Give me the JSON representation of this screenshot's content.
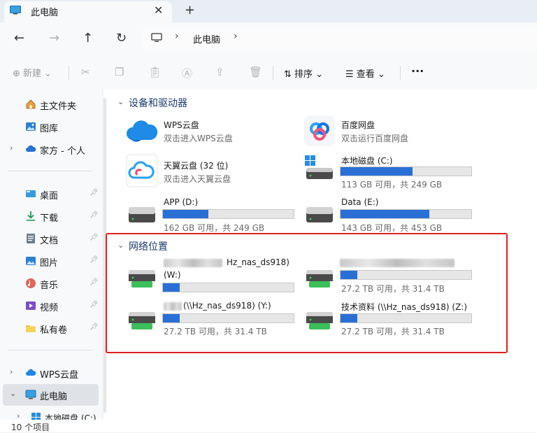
{
  "window": {
    "tab_title": "此电脑",
    "close_glyph": "✕",
    "new_tab_glyph": "+"
  },
  "address": {
    "location": "此电脑",
    "sep": "›"
  },
  "toolbar": {
    "new_label": "新建",
    "sort_label": "排序",
    "view_label": "查看",
    "more_glyph": "···"
  },
  "sidebar": {
    "quick": [
      {
        "label": "主文件夹",
        "icon": "home-icon"
      },
      {
        "label": "图库",
        "icon": "gallery-icon"
      },
      {
        "label": "家方 - 个人",
        "icon": "cloud-icon"
      }
    ],
    "pinned": [
      {
        "label": "桌面",
        "icon": "desktop-icon"
      },
      {
        "label": "下载",
        "icon": "download-icon"
      },
      {
        "label": "文档",
        "icon": "document-icon"
      },
      {
        "label": "图片",
        "icon": "picture-icon"
      },
      {
        "label": "音乐",
        "icon": "music-icon"
      },
      {
        "label": "视频",
        "icon": "video-icon"
      },
      {
        "label": "私有卷",
        "icon": "folder-icon"
      }
    ],
    "tree": [
      {
        "label": "WPS云盘",
        "icon": "wps-cloud-icon"
      },
      {
        "label": "此电脑",
        "icon": "pc-icon",
        "selected": true
      },
      {
        "label": "本地磁盘 (C:)",
        "icon": "windows-drive-icon"
      }
    ]
  },
  "groups": {
    "devices_title": "设备和驱动器",
    "network_title": "网络位置"
  },
  "devices": [
    {
      "name": "WPS云盘",
      "sub": "双击进入WPS云盘",
      "icon": "wps-cloud-logo-icon"
    },
    {
      "name": "百度网盘",
      "sub": "双击运行百度网盘",
      "icon": "baidu-netdisk-icon"
    },
    {
      "name": "天翼云盘 (32 位)",
      "sub": "双击进入天翼云盘",
      "icon": "tianyi-cloud-icon"
    },
    {
      "name": "本地磁盘 (C:)",
      "sub": "113 GB 可用，共 249 GB",
      "usage": 0.55,
      "icon": "windows-drive-icon"
    },
    {
      "name": "APP (D:)",
      "sub": "162 GB 可用，共 249 GB",
      "usage": 0.35,
      "icon": "drive-icon"
    },
    {
      "name": "Data (E:)",
      "sub": "143 GB 可用，共 453 GB",
      "usage": 0.68,
      "icon": "drive-icon"
    }
  ],
  "network": [
    {
      "name": "Hz_nas_ds918)",
      "name2": "(W:)",
      "sub": "",
      "usage": 0.13,
      "icon": "network-drive-icon"
    },
    {
      "name": "",
      "sub": "27.2 TB 可用，共 31.4 TB",
      "usage": 0.13,
      "icon": "network-drive-icon"
    },
    {
      "name": "(\\\\Hz_nas_ds918) (Y:)",
      "sub": "27.2 TB 可用，共 31.4 TB",
      "usage": 0.13,
      "icon": "network-drive-icon"
    },
    {
      "name": "技术资料 (\\\\Hz_nas_ds918) (Z:)",
      "sub": "27.2 TB 可用，共 31.4 TB",
      "usage": 0.13,
      "icon": "network-drive-icon"
    }
  ],
  "status": {
    "item_count": "10 个项目"
  },
  "colors": {
    "accent": "#2a6fd6",
    "highlight_frame": "#e0201f",
    "group_title": "#1b3a6b"
  }
}
